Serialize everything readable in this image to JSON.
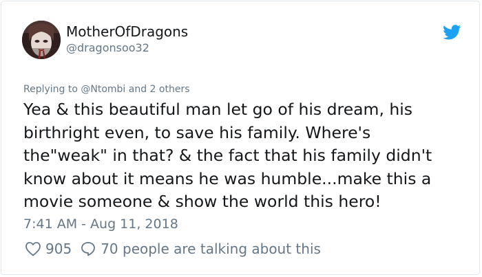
{
  "user": {
    "display_name": "MotherOfDragons",
    "handle": "@dragonsoo32"
  },
  "tweet": {
    "reply_line": "Replying to @Ntombi and 2 others",
    "text_lines": [
      "Yea & this beautiful man let go of his dream, his",
      "birthright even, to save his family. Where's",
      "the\"weak\" in that? & the fact that his family didn't",
      "know about it means he was humble...make this a",
      "movie someone & show the world this hero!"
    ],
    "timestamp": "7:41 AM - Aug 11, 2018",
    "like_count": "905",
    "talking_text": "70 people are talking about this"
  },
  "icons": {
    "brand": "twitter-bird-icon",
    "like": "heart-icon",
    "reply": "speech-bubble-icon"
  },
  "colors": {
    "brand": "#1da1f2",
    "text": "#14171a",
    "muted": "#657786",
    "border": "#e1e8ed"
  }
}
